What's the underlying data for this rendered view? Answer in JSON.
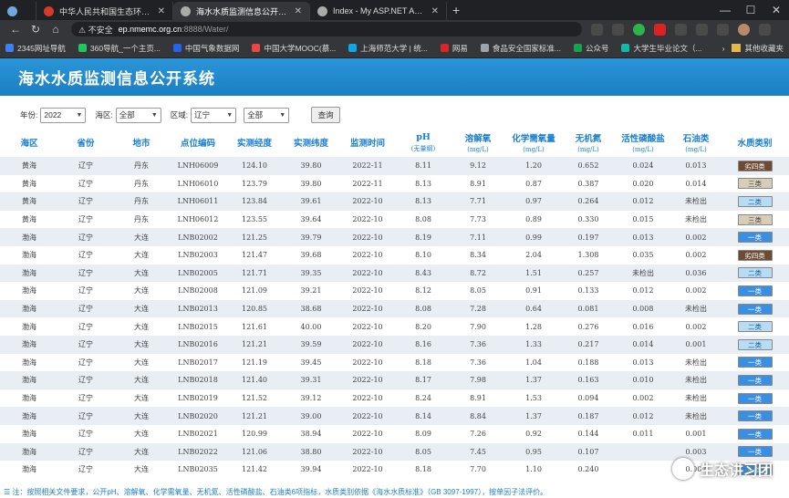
{
  "browser": {
    "tabs": [
      {
        "label": "",
        "icon_color": "#6fa8dc"
      },
      {
        "label": "中华人民共和国生态环境部",
        "icon_color": "#d9392b"
      },
      {
        "label": "海水水质监测信息公开系统",
        "icon_color": "#aaaaaa"
      },
      {
        "label": "Index - My ASP.NET Application",
        "icon_color": "#aaaaaa"
      }
    ],
    "security_label": "不安全",
    "url_host": "ep.nmemc.org.cn",
    "url_path": ":8888/Water/",
    "bookmarks": [
      {
        "label": "2345网址导航",
        "icon_color": "#3b82f6"
      },
      {
        "label": "360导航_一个主页...",
        "icon_color": "#22c55e"
      },
      {
        "label": "中国气象数据网",
        "icon_color": "#2563eb"
      },
      {
        "label": "中国大学MOOC(慕...",
        "icon_color": "#ef4444"
      },
      {
        "label": "上海师范大学 | 统...",
        "icon_color": "#0ea5e9"
      },
      {
        "label": "网易",
        "icon_color": "#dc2626"
      },
      {
        "label": "食品安全国家标准...",
        "icon_color": "#9ca3af"
      },
      {
        "label": "公众号",
        "icon_color": "#16a34a"
      },
      {
        "label": "大学生毕业论文（...",
        "icon_color": "#14b8a6"
      }
    ],
    "other_bookmarks": "其他收藏夹"
  },
  "page": {
    "title": "海水水质监测信息公开系统",
    "filters": {
      "year_label": "年份:",
      "year_value": "2022",
      "sea_label": "海区:",
      "sea_value": "全部",
      "region_label": "区域:",
      "region_value": "辽宁",
      "region2_value": "全部",
      "query_button": "查询"
    },
    "columns": [
      {
        "title": "海区",
        "unit": ""
      },
      {
        "title": "省份",
        "unit": ""
      },
      {
        "title": "地市",
        "unit": ""
      },
      {
        "title": "点位编码",
        "unit": ""
      },
      {
        "title": "实测经度",
        "unit": ""
      },
      {
        "title": "实测纬度",
        "unit": ""
      },
      {
        "title": "监测时间",
        "unit": ""
      },
      {
        "title": "pH",
        "unit": "(无量纲)"
      },
      {
        "title": "溶解氧",
        "unit": "(mg/L)"
      },
      {
        "title": "化学需氧量",
        "unit": "(mg/L)"
      },
      {
        "title": "无机氮",
        "unit": "(mg/L)"
      },
      {
        "title": "活性磷酸盐",
        "unit": "(mg/L)"
      },
      {
        "title": "石油类",
        "unit": "(mg/L)"
      },
      {
        "title": "水质类别",
        "unit": ""
      }
    ],
    "rows": [
      [
        "黄海",
        "辽宁",
        "丹东",
        "LNH06009",
        "124.10",
        "39.80",
        "2022-11",
        "8.11",
        "9.12",
        "1.20",
        "0.652",
        "0.024",
        "0.013",
        "劣四类"
      ],
      [
        "黄海",
        "辽宁",
        "丹东",
        "LNH06010",
        "123.79",
        "39.80",
        "2022-11",
        "8.13",
        "8.91",
        "0.87",
        "0.387",
        "0.020",
        "0.014",
        "三类"
      ],
      [
        "黄海",
        "辽宁",
        "丹东",
        "LNH06011",
        "123.84",
        "39.61",
        "2022-10",
        "8.13",
        "7.71",
        "0.97",
        "0.264",
        "0.012",
        "未检出",
        "二类"
      ],
      [
        "黄海",
        "辽宁",
        "丹东",
        "LNH06012",
        "123.55",
        "39.64",
        "2022-10",
        "8.08",
        "7.73",
        "0.89",
        "0.330",
        "0.015",
        "未检出",
        "三类"
      ],
      [
        "渤海",
        "辽宁",
        "大连",
        "LNB02002",
        "121.25",
        "39.79",
        "2022-10",
        "8.19",
        "7.11",
        "0.99",
        "0.197",
        "0.013",
        "0.002",
        "一类"
      ],
      [
        "渤海",
        "辽宁",
        "大连",
        "LNB02003",
        "121.47",
        "39.68",
        "2022-10",
        "8.10",
        "8.34",
        "2.04",
        "1.308",
        "0.035",
        "0.002",
        "劣四类"
      ],
      [
        "渤海",
        "辽宁",
        "大连",
        "LNB02005",
        "121.71",
        "39.35",
        "2022-10",
        "8.43",
        "8.72",
        "1.51",
        "0.257",
        "未检出",
        "0.036",
        "二类"
      ],
      [
        "渤海",
        "辽宁",
        "大连",
        "LNB02008",
        "121.09",
        "39.21",
        "2022-10",
        "8.12",
        "8.05",
        "0.91",
        "0.133",
        "0.012",
        "0.002",
        "一类"
      ],
      [
        "渤海",
        "辽宁",
        "大连",
        "LNB02013",
        "120.85",
        "38.68",
        "2022-10",
        "8.08",
        "7.28",
        "0.64",
        "0.081",
        "0.008",
        "未检出",
        "一类"
      ],
      [
        "渤海",
        "辽宁",
        "大连",
        "LNB02015",
        "121.61",
        "40.00",
        "2022-10",
        "8.20",
        "7.90",
        "1.28",
        "0.276",
        "0.016",
        "0.002",
        "二类"
      ],
      [
        "渤海",
        "辽宁",
        "大连",
        "LNB02016",
        "121.21",
        "39.59",
        "2022-10",
        "8.16",
        "7.36",
        "1.33",
        "0.217",
        "0.014",
        "0.001",
        "二类"
      ],
      [
        "渤海",
        "辽宁",
        "大连",
        "LNB02017",
        "121.19",
        "39.45",
        "2022-10",
        "8.18",
        "7.36",
        "1.04",
        "0.188",
        "0.013",
        "未检出",
        "一类"
      ],
      [
        "渤海",
        "辽宁",
        "大连",
        "LNB02018",
        "121.40",
        "39.31",
        "2022-10",
        "8.17",
        "7.98",
        "1.37",
        "0.163",
        "0.010",
        "未检出",
        "一类"
      ],
      [
        "渤海",
        "辽宁",
        "大连",
        "LNB02019",
        "121.52",
        "39.12",
        "2022-10",
        "8.24",
        "8.91",
        "1.53",
        "0.094",
        "0.002",
        "未检出",
        "一类"
      ],
      [
        "渤海",
        "辽宁",
        "大连",
        "LNB02020",
        "121.21",
        "39.00",
        "2022-10",
        "8.14",
        "8.84",
        "1.37",
        "0.187",
        "0.012",
        "未检出",
        "一类"
      ],
      [
        "渤海",
        "辽宁",
        "大连",
        "LNB02021",
        "120.99",
        "38.94",
        "2022-10",
        "8.09",
        "7.26",
        "0.92",
        "0.144",
        "0.011",
        "0.001",
        "一类"
      ],
      [
        "渤海",
        "辽宁",
        "大连",
        "LNB02022",
        "121.06",
        "38.80",
        "2022-10",
        "8.05",
        "7.45",
        "0.95",
        "0.107",
        "",
        "0.003",
        "一类"
      ],
      [
        "渤海",
        "辽宁",
        "大连",
        "LNB02035",
        "121.42",
        "39.94",
        "2022-10",
        "8.18",
        "7.70",
        "1.10",
        "0.240",
        "",
        "0.002",
        "一类"
      ]
    ],
    "category_colors": {
      "一类": {
        "bg": "#3b8fe0",
        "fg": "#ffffff"
      },
      "二类": {
        "bg": "#b9dcf5",
        "fg": "#1a5e9a"
      },
      "三类": {
        "bg": "#d8cdb8",
        "fg": "#444444"
      },
      "劣四类": {
        "bg": "#6e4a33",
        "fg": "#ffffff"
      }
    },
    "note": "注：按照相关文件要求，公开pH、溶解氧、化学需氧量、无机氮、活性磷酸盐、石油类6项指标，水质类别依据《海水水质标准》（GB 3097-1997），按单因子法评价。",
    "watermark": "生态讲习团"
  }
}
